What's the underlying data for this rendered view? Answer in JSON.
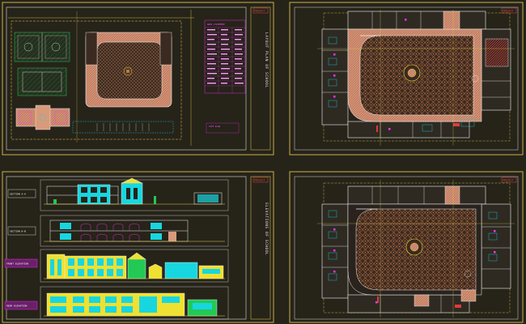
{
  "drawing": {
    "background": "#262319",
    "sheets": [
      {
        "id": "site-plan-sheet",
        "title": "LAYOUT PLAN OF SCHOOL",
        "stamp": "PROJECT",
        "schedule_title": "AREA STATEMENT",
        "note": "SITE PLAN"
      },
      {
        "id": "ground-floor-sheet",
        "stamp": "PROJECT"
      },
      {
        "id": "elevations-sheet",
        "title": "ELEVATIONS OF SCHOOL",
        "stamp": "PROJECT",
        "labels": [
          "SECTION A-A",
          "SECTION B-B",
          "FRONT ELEVATION",
          "REAR ELEVATION"
        ]
      },
      {
        "id": "first-floor-sheet",
        "stamp": "PROJECT"
      }
    ],
    "colors": {
      "frame_yellow": "#c9b14a",
      "frame_white": "#d9d9d9",
      "wall_white": "#f2f2f2",
      "grid_yellow": "#e6d24d",
      "cyan": "#18d6e0",
      "magenta": "#ff33ff",
      "brown_hatch": "#8a5536",
      "salmon": "#d99a7a",
      "yellow_fill": "#f0e030",
      "green": "#22c955",
      "red": "#e03a3a"
    }
  }
}
